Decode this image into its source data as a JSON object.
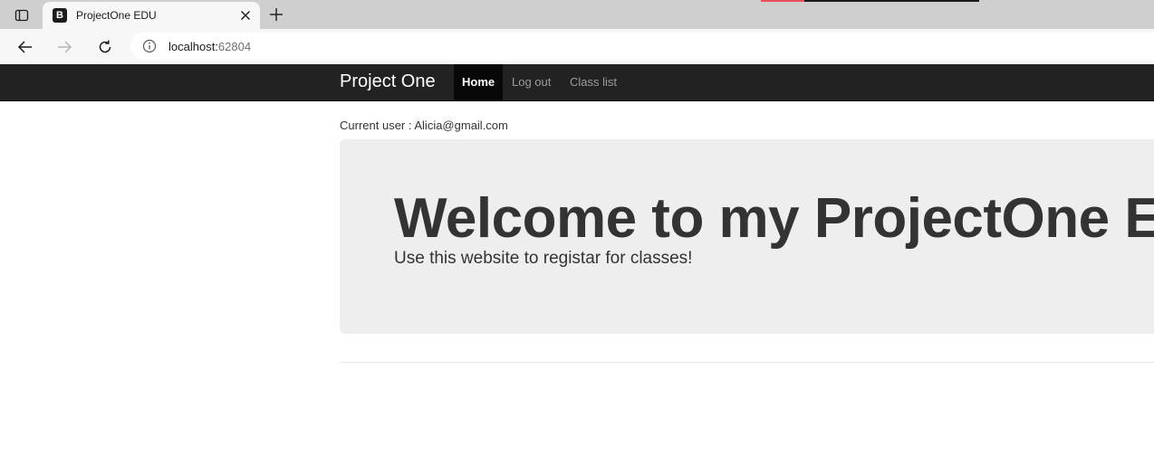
{
  "browser": {
    "tab_title": "ProjectOne EDU",
    "favicon_letter": "B",
    "url_host": "localhost:",
    "url_port": "62804",
    "icons": {
      "tab_actions": "tab-actions-icon",
      "close": "close-icon",
      "new_tab": "plus-icon",
      "back": "arrow-left-icon",
      "forward": "arrow-right-icon",
      "reload": "reload-icon",
      "site_info": "info-icon"
    }
  },
  "navbar": {
    "brand": "Project One",
    "links": [
      {
        "label": "Home",
        "active": true
      },
      {
        "label": "Log out",
        "active": false
      },
      {
        "label": "Class list",
        "active": false
      }
    ]
  },
  "main": {
    "current_user": "Current user : Alicia@gmail.com",
    "jumbotron": {
      "heading": "Welcome to my ProjectOne EDU",
      "subtext": "Use this website to registar for classes!"
    }
  },
  "colors": {
    "navbar_bg": "#222222",
    "nav_active_bg": "#080808",
    "jumbotron_bg": "#eeeeee",
    "text": "#333333"
  }
}
